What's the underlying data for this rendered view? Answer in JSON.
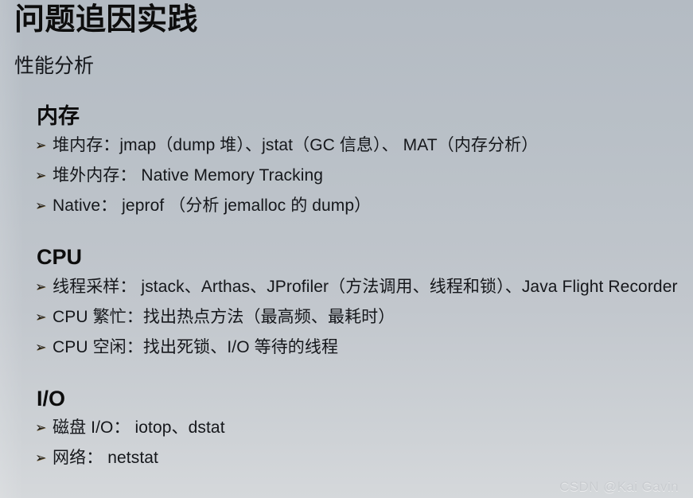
{
  "slide": {
    "title": "问题追因实践",
    "subtitle": "性能分析",
    "background_top_color": "#b4bbc3",
    "background_bottom_color": "#d5d8db",
    "text_color": "#15171b",
    "bullet_glyph": "➢"
  },
  "sections": [
    {
      "heading": "内存",
      "bullets": [
        "堆内存：jmap（dump 堆）、jstat（GC 信息）、 MAT（内存分析）",
        "堆外内存： Native Memory Tracking",
        "Native： jeprof （分析 jemalloc 的 dump）"
      ]
    },
    {
      "heading": "CPU",
      "bullets": [
        "线程采样： jstack、Arthas、JProfiler（方法调用、线程和锁）、Java Flight Recorder",
        "CPU 繁忙：找出热点方法（最高频、最耗时）",
        "CPU 空闲：找出死锁、I/O 等待的线程"
      ]
    },
    {
      "heading": "I/O",
      "bullets": [
        "磁盘 I/O： iotop、dstat",
        "网络： netstat"
      ]
    }
  ],
  "watermark": {
    "text": "CSDN @Kai Gavin"
  }
}
